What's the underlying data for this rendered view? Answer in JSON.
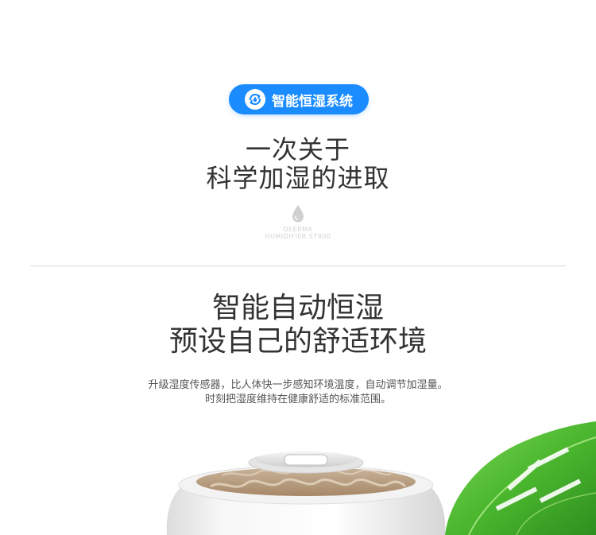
{
  "badge": {
    "label": "智能恒湿系统",
    "icon": "refresh-droplet-icon",
    "bg_color": "#1a8cff"
  },
  "section1": {
    "line1": "一次关于",
    "line2": "科学加湿的进取",
    "brand_line1": "DEERMA",
    "brand_line2": "HUMIDIFIER ST800",
    "icon": "water-drop-icon"
  },
  "section2": {
    "line1": "智能自动恒湿",
    "line2": "预设自己的舒适环境",
    "desc_line1": "升级湿度传感器，比人体快一步感知环境温度，自动调节加湿量。",
    "desc_line2": "时刻把湿度维持在健康舒适的标准范围。"
  },
  "visuals": {
    "product": "humidifier-product-image",
    "leaf": "monstera-leaf-image"
  }
}
